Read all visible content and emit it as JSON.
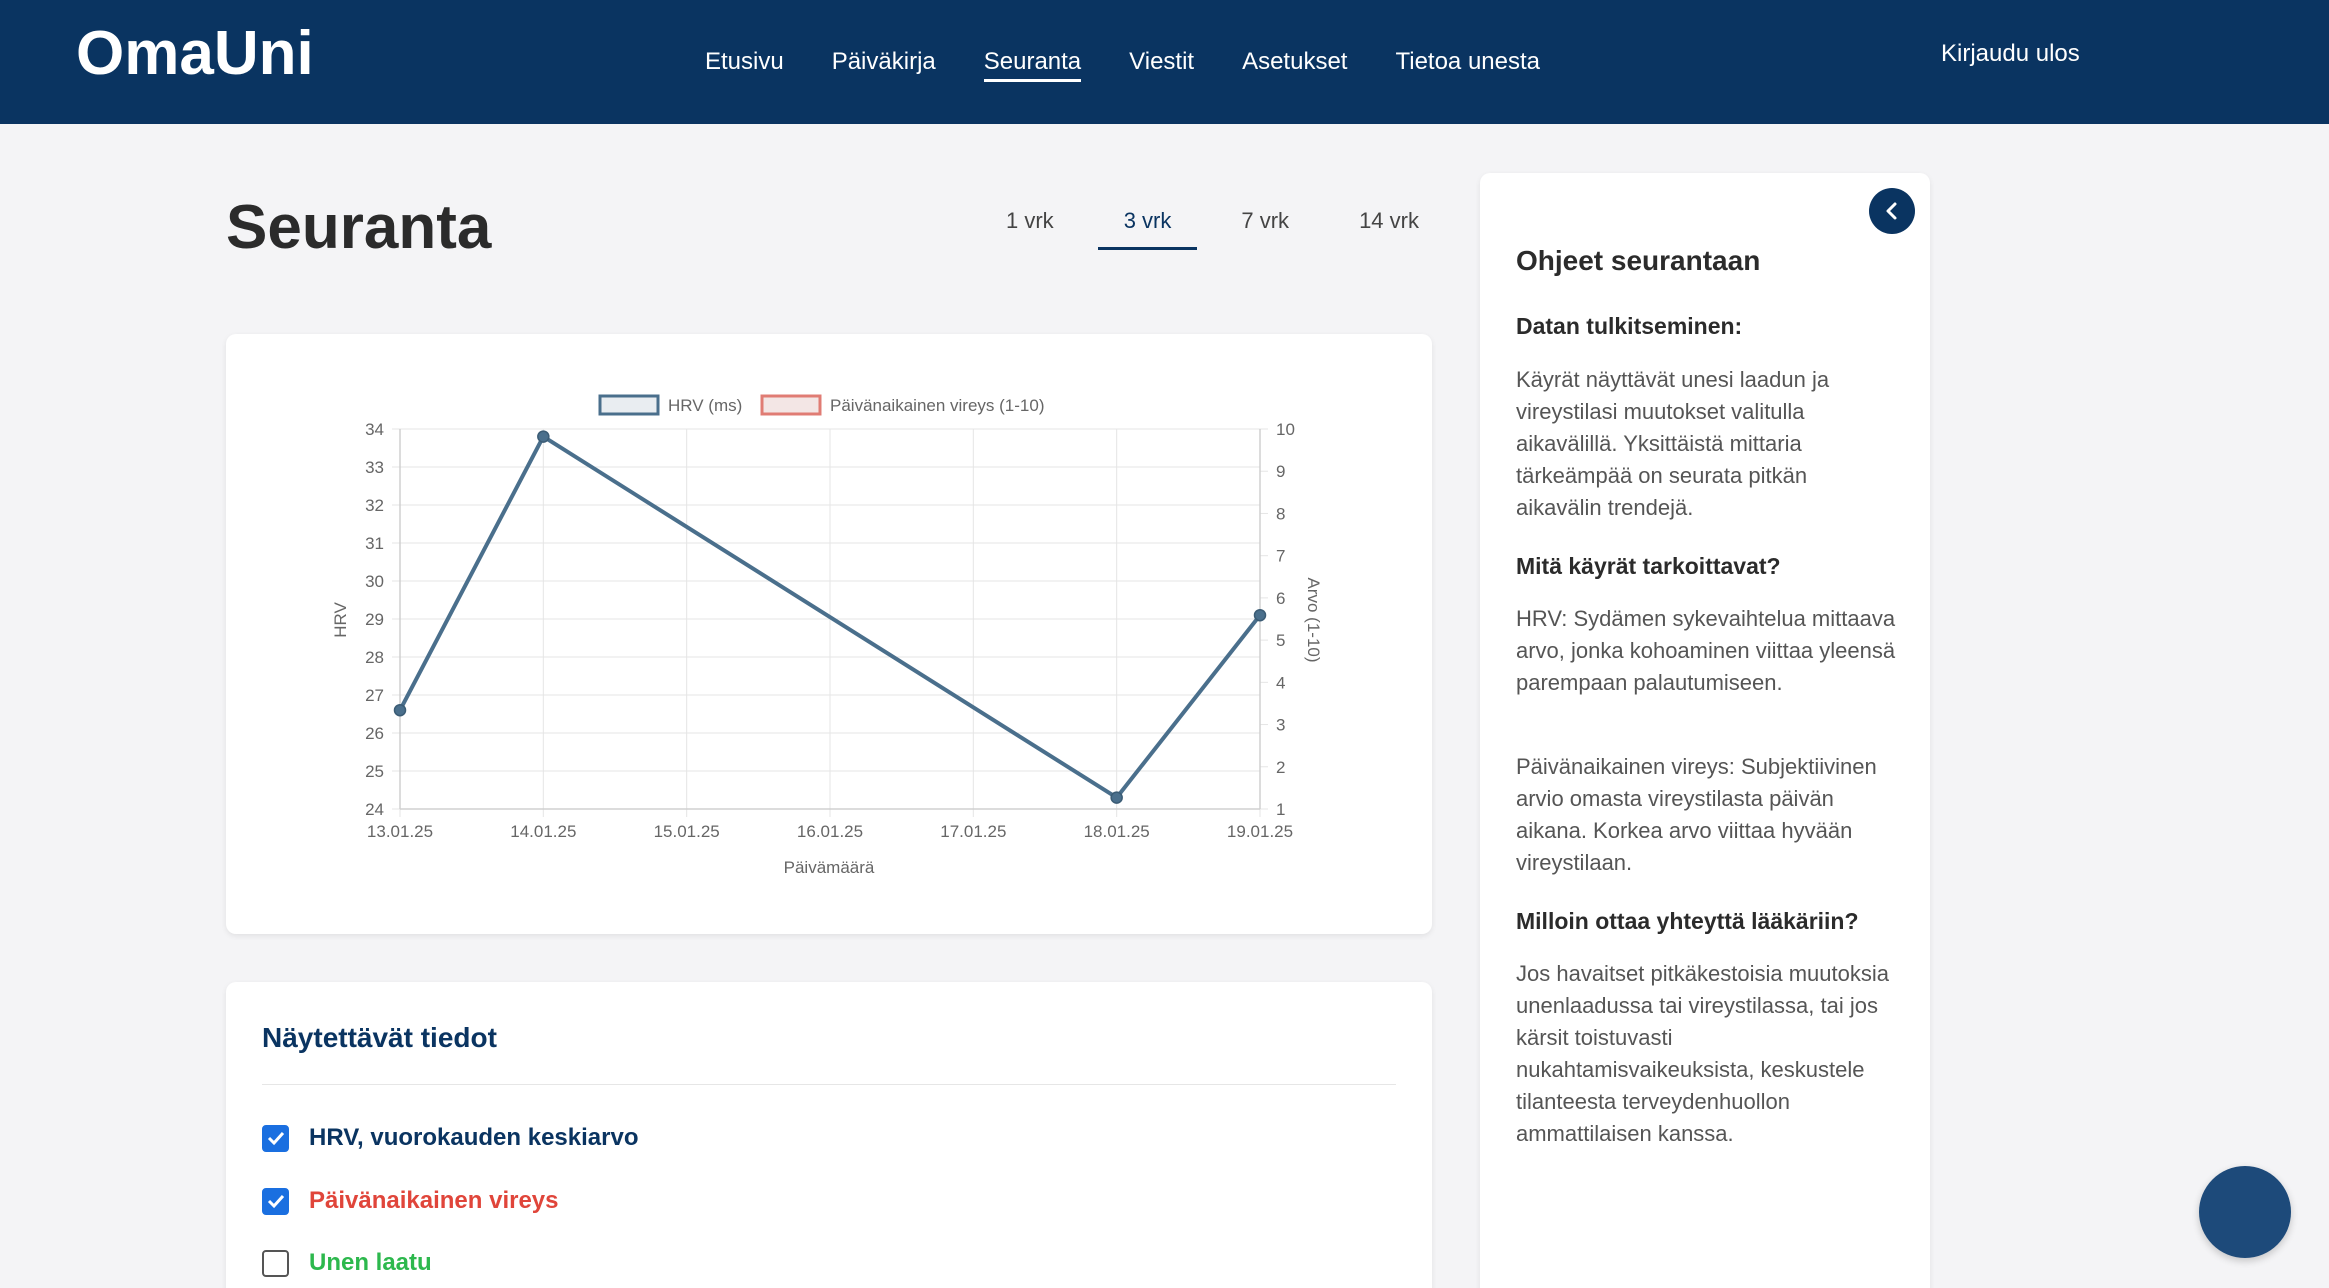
{
  "app": {
    "logo": "OmaUni"
  },
  "nav": {
    "items": [
      {
        "label": "Etusivu",
        "active": false
      },
      {
        "label": "Päiväkirja",
        "active": false
      },
      {
        "label": "Seuranta",
        "active": true
      },
      {
        "label": "Viestit",
        "active": false
      },
      {
        "label": "Asetukset",
        "active": false
      },
      {
        "label": "Tietoa unesta",
        "active": false
      }
    ],
    "logout": "Kirjaudu ulos"
  },
  "page": {
    "title": "Seuranta"
  },
  "tabs": [
    {
      "label": "1 vrk",
      "active": false
    },
    {
      "label": "3 vrk",
      "active": true
    },
    {
      "label": "7 vrk",
      "active": false
    },
    {
      "label": "14 vrk",
      "active": false
    }
  ],
  "chart_data": {
    "type": "line",
    "title": "",
    "legend": [
      "HRV (ms)",
      "Päivänaikainen vireys (1-10)"
    ],
    "legend_position": "top",
    "xlabel": "Päivämäärä",
    "ylabel": "HRV",
    "y2label": "Arvo (1-10)",
    "ylim": [
      24,
      34
    ],
    "y2lim": [
      1,
      10
    ],
    "x": [
      "13.01.25",
      "14.01.25",
      "15.01.25",
      "16.01.25",
      "17.01.25",
      "18.01.25",
      "19.01.25"
    ],
    "yticks": [
      "24",
      "25",
      "26",
      "27",
      "28",
      "29",
      "30",
      "31",
      "32",
      "33",
      "34"
    ],
    "y2ticks": [
      "1",
      "2",
      "3",
      "4",
      "5",
      "6",
      "7",
      "8",
      "9",
      "10"
    ],
    "grid": true,
    "series": [
      {
        "name": "HRV (ms)",
        "axis": "left",
        "color": "#4a6f8c",
        "points": [
          {
            "x": "13.01.25",
            "y": 26.6
          },
          {
            "x": "14.01.25",
            "y": 33.8
          },
          {
            "x": "18.01.25",
            "y": 24.3
          },
          {
            "x": "19.01.25",
            "y": 29.1
          }
        ]
      },
      {
        "name": "Päivänaikainen vireys (1-10)",
        "axis": "right",
        "color": "#e07c74",
        "points": []
      }
    ]
  },
  "options": {
    "title": "Näytettävät tiedot",
    "items": [
      {
        "label": "HRV, vuorokauden keskiarvo",
        "checked": true,
        "color": "#0a3461"
      },
      {
        "label": "Päivänaikainen vireys",
        "checked": true,
        "color": "#e0453a"
      },
      {
        "label": "Unen laatu",
        "checked": false,
        "color": "#2db84d"
      }
    ]
  },
  "sidebar": {
    "title": "Ohjeet seurantaan",
    "section1_title": "Datan tulkitseminen:",
    "section1_text": "Käyrät näyttävät unesi laadun ja vireystilasi muutokset valitulla aikavälillä. Yksittäistä mittaria tärkeämpää on seurata pitkän aikavälin trendejä.",
    "section2_title": "Mitä käyrät tarkoittavat?",
    "section2_text_hrv": "HRV: Sydämen sykevaihtelua mittaava arvo, jonka kohoaminen viittaa yleensä parempaan palautumiseen.",
    "section2_text_vireys": "Päivänaikainen vireys: Subjektiivinen arvio omasta vireystilasta päivän aikana. Korkea arvo viittaa hyvään vireystilaan.",
    "section3_title": "Milloin ottaa yhteyttä lääkäriin?",
    "section3_text": "Jos havaitset pitkäkestoisia muutoksia unenlaadussa tai vireystilassa, tai jos kärsit toistuvasti nukahtamisvaikeuksista, keskustele tilanteesta terveydenhuollon ammattilaisen kanssa."
  },
  "colors": {
    "brand": "#0a3461",
    "accent": "#1a6fe0",
    "background": "#f4f4f6"
  }
}
